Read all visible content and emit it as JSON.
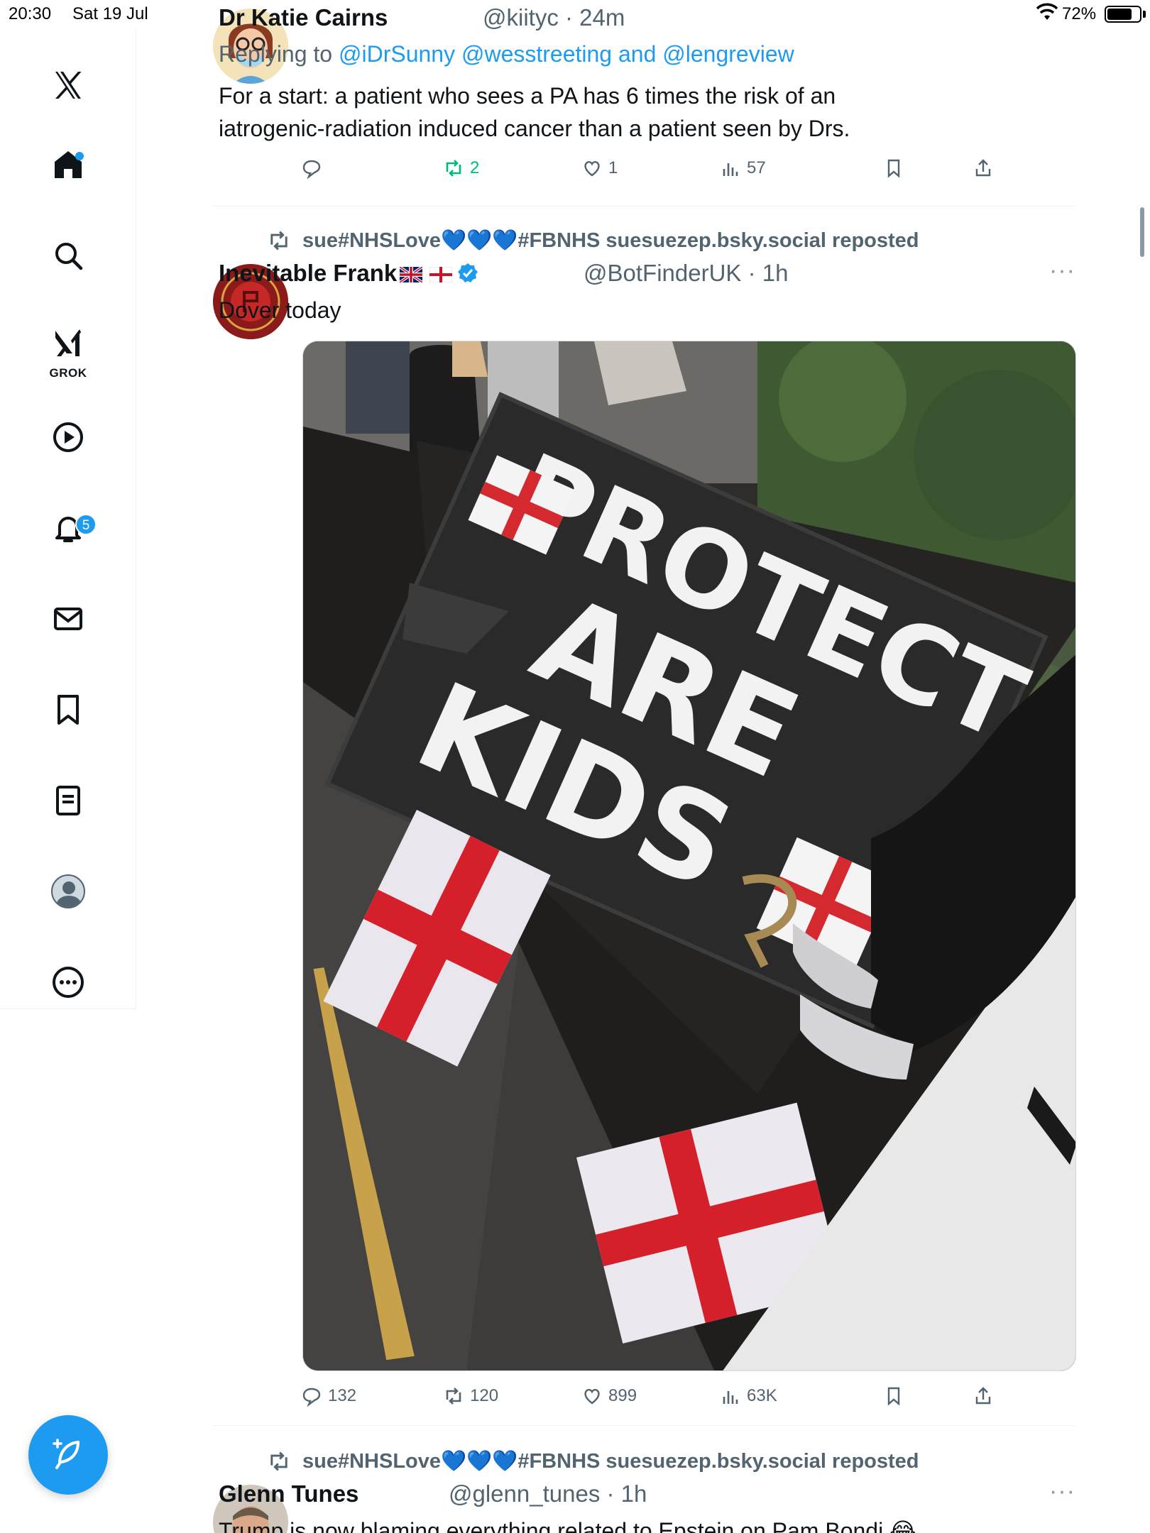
{
  "status_bar": {
    "time": "20:30",
    "date": "Sat 19 Jul",
    "battery": "72%"
  },
  "sidebar": {
    "grok_label": "GROK",
    "notifications_badge": "5"
  },
  "tweets": [
    {
      "author_name": "Dr Katie Cairns",
      "handle_time": "@kiityc · 24m",
      "replying_prefix": "Replying to ",
      "replying_to": "@iDrSunny @wesstreeting and @lengreview",
      "text": "For a start: a patient who sees a PA has 6 times the risk of an iatrogenic-radiation induced cancer than a patient seen by Drs.",
      "replies": "",
      "reposts": "2",
      "likes": "1",
      "views": "57"
    },
    {
      "repost_line": "sue#NHSLove💙💙💙#FBNHS suesuezep.bsky.social reposted",
      "author_name": "Inevitable Frank",
      "handle_time": "@BotFinderUK · 1h",
      "more": "···",
      "text": "Dover today",
      "image_sign_text": [
        "PROTECT",
        "ARE",
        "KIDS"
      ],
      "replies": "132",
      "reposts": "120",
      "likes": "899",
      "views": "63K"
    },
    {
      "repost_line": "sue#NHSLove💙💙💙#FBNHS suesuezep.bsky.social reposted",
      "author_name": "Glenn Tunes",
      "handle_time": "@glenn_tunes · 1h",
      "more": "···",
      "text": "Trump is now blaming everything related to Epstein on Pam Bondi 😂"
    }
  ],
  "colors": {
    "accent": "#1d9bf0",
    "repost_green": "#00ba7c",
    "secondary_text": "#536471"
  }
}
